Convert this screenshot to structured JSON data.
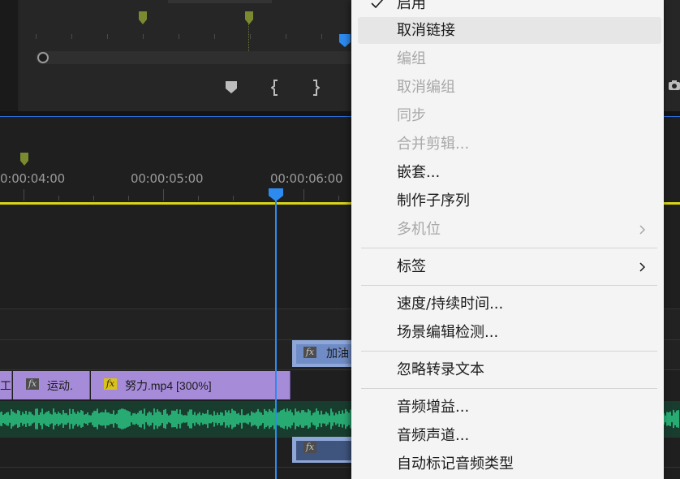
{
  "timeline": {
    "timecodes": [
      "0:00:04:00",
      "00:00:05:00",
      "00:00:06:00"
    ],
    "clips": {
      "v2_clip_label": "加油",
      "v1_clip_a_label": "工",
      "v1_clip_b_label": "运动.",
      "v1_clip_c_label": "努力.mp4 [300%]",
      "fx_label": "fx"
    }
  },
  "context_menu": {
    "items": [
      {
        "label": "启用",
        "checked": true,
        "enabled": true
      },
      {
        "label": "取消链接",
        "enabled": true,
        "hovered": true
      },
      {
        "label": "编组",
        "enabled": false
      },
      {
        "label": "取消编组",
        "enabled": false
      },
      {
        "label": "同步",
        "enabled": false
      },
      {
        "label": "合并剪辑...",
        "enabled": false
      },
      {
        "label": "嵌套...",
        "enabled": true
      },
      {
        "label": "制作子序列",
        "enabled": true
      },
      {
        "label": "多机位",
        "enabled": false,
        "submenu": true
      },
      {
        "label": "标签",
        "enabled": true,
        "submenu": true
      },
      {
        "label": "速度/持续时间...",
        "enabled": true
      },
      {
        "label": "场景编辑检测...",
        "enabled": true
      },
      {
        "label": "忽略转录文本",
        "enabled": true
      },
      {
        "label": "音频增益...",
        "enabled": true
      },
      {
        "label": "音频声道...",
        "enabled": true
      },
      {
        "label": "自动标记音频类型",
        "enabled": true
      }
    ]
  },
  "colors": {
    "playhead": "#2d8bf0",
    "work_area_bar": "#d9d41a",
    "video_clip": "#a68bd9",
    "audio_wave": "#2ecf8a",
    "marker": "#7a8a30"
  },
  "icons": {
    "check": "check-icon",
    "submenu": "chevron-right-icon",
    "marker": "marker-icon",
    "mark_in": "mark-in-icon",
    "mark_out": "mark-out-icon",
    "camera": "camera-icon",
    "playhead": "playhead-icon"
  }
}
